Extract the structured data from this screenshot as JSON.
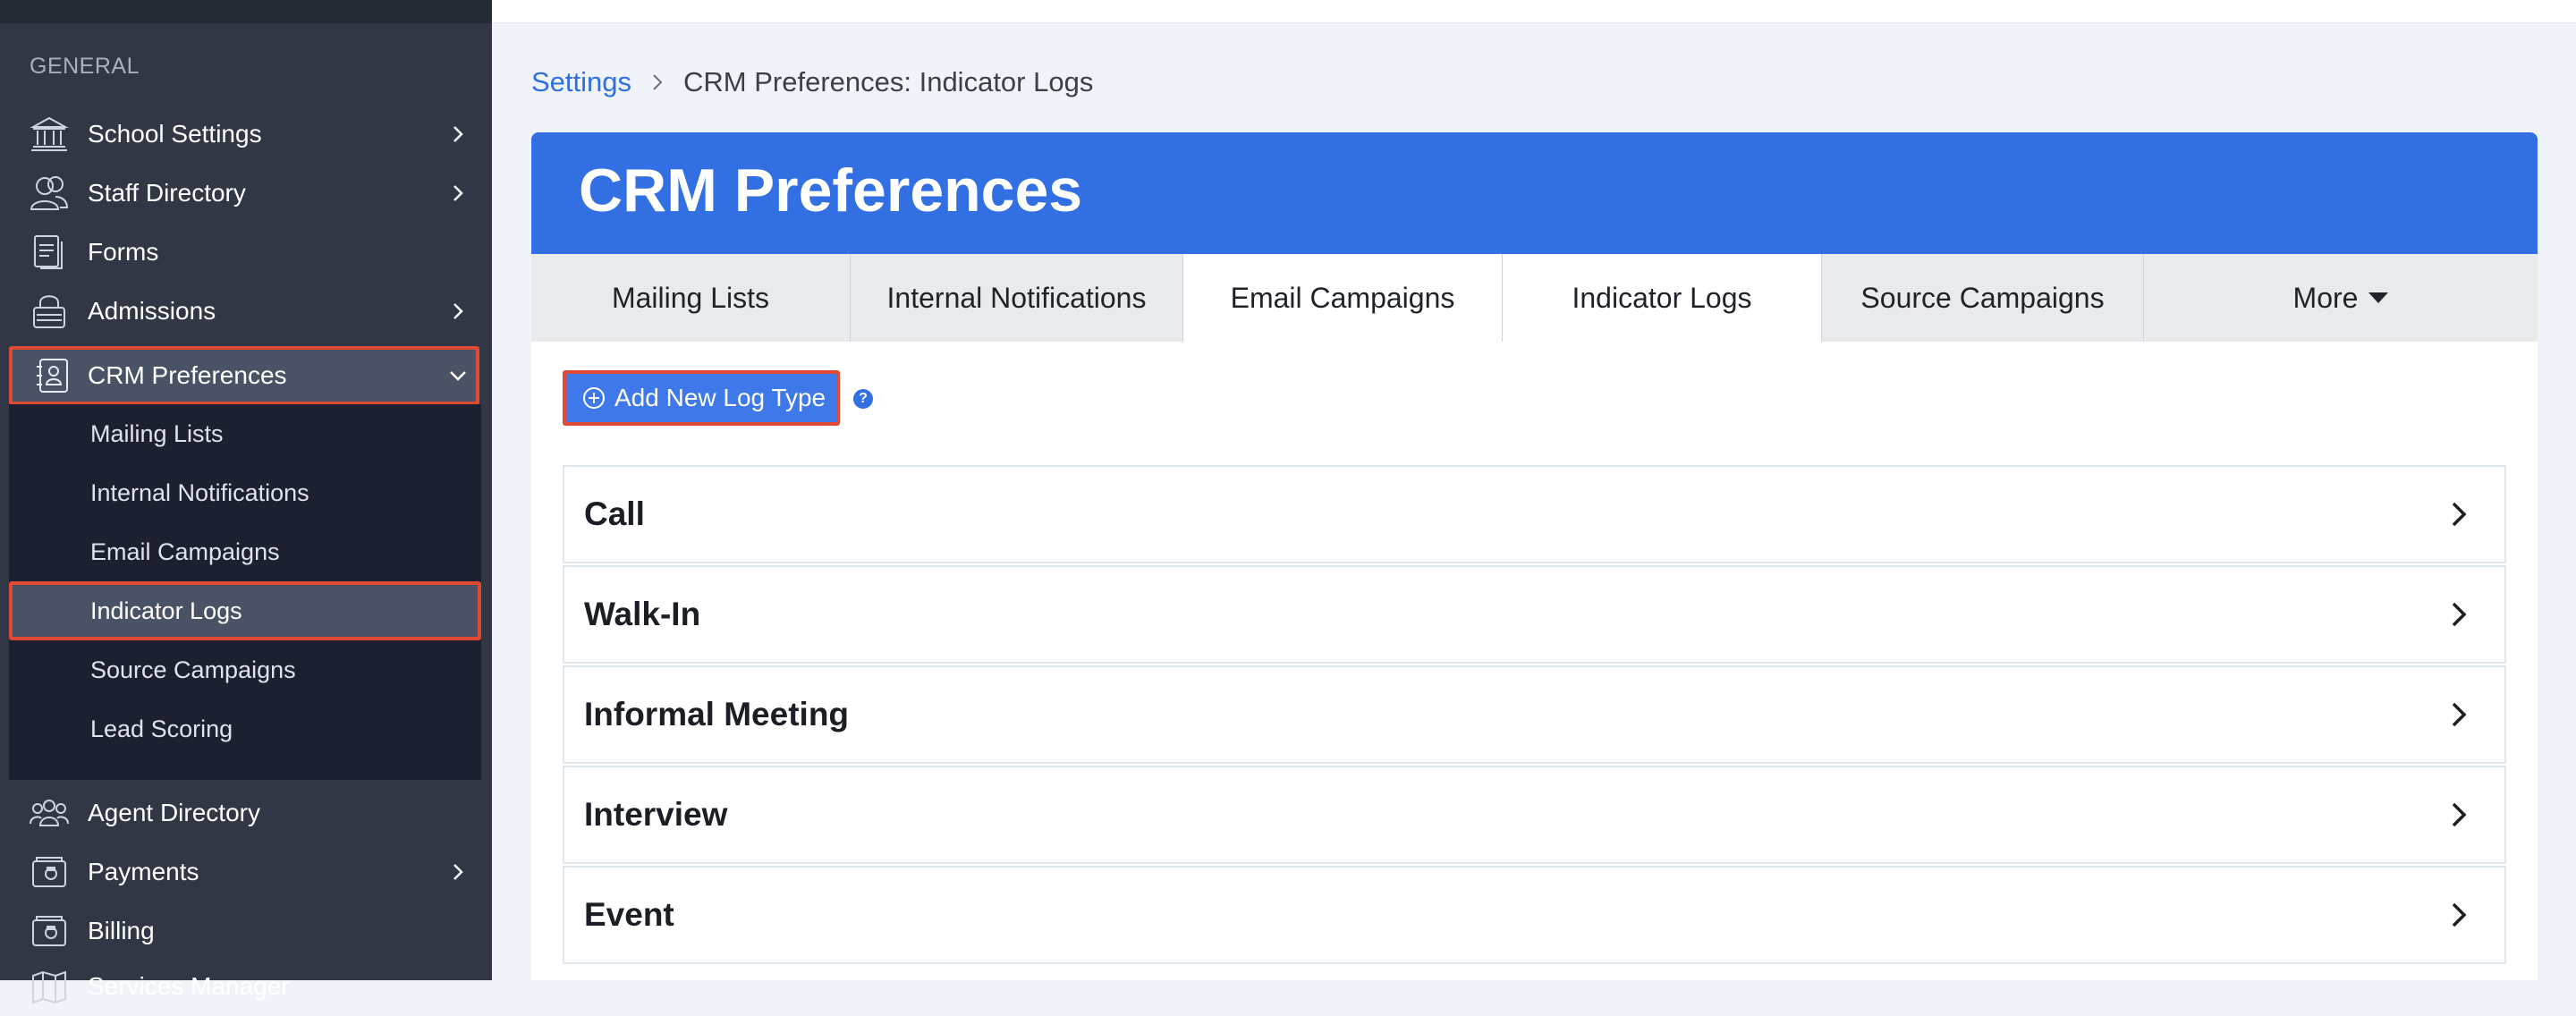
{
  "sidebar": {
    "section_label": "GENERAL",
    "items": [
      {
        "label": "School Settings"
      },
      {
        "label": "Staff Directory"
      },
      {
        "label": "Forms"
      },
      {
        "label": "Admissions"
      },
      {
        "label": "CRM Preferences"
      },
      {
        "label": "Agent Directory"
      },
      {
        "label": "Payments"
      },
      {
        "label": "Billing"
      },
      {
        "label": "Services Manager"
      }
    ],
    "crm_submenu": [
      {
        "label": "Mailing Lists"
      },
      {
        "label": "Internal Notifications"
      },
      {
        "label": "Email Campaigns"
      },
      {
        "label": "Indicator Logs"
      },
      {
        "label": "Source Campaigns"
      },
      {
        "label": "Lead Scoring"
      }
    ]
  },
  "breadcrumb": {
    "root": "Settings",
    "current": "CRM Preferences: Indicator Logs"
  },
  "panel": {
    "title": "CRM Preferences",
    "tabs": [
      {
        "label": "Mailing Lists"
      },
      {
        "label": "Internal Notifications"
      },
      {
        "label": "Email Campaigns"
      },
      {
        "label": "Indicator Logs"
      },
      {
        "label": "Source Campaigns"
      },
      {
        "label": "More"
      }
    ],
    "add_button_label": "Add New Log Type",
    "help_glyph": "?",
    "log_types": [
      {
        "name": "Call"
      },
      {
        "name": "Walk-In"
      },
      {
        "name": "Informal Meeting"
      },
      {
        "name": "Interview"
      },
      {
        "name": "Event"
      }
    ]
  },
  "colors": {
    "sidebar_bg": "#323746",
    "submenu_bg": "#1c2030",
    "highlight_border": "#e04a35",
    "brand_blue": "#326fe3",
    "link_blue": "#2f6fde",
    "page_bg": "#f0f4fa"
  },
  "icons": {
    "school_settings": "bank-building-icon",
    "staff_directory": "people-icon",
    "forms": "documents-icon",
    "admissions": "lock-icon",
    "crm_preferences": "contact-book-icon",
    "agent_directory": "group-icon",
    "payments": "wallet-icon",
    "billing": "camera-wallet-icon",
    "services_manager": "map-icon"
  }
}
